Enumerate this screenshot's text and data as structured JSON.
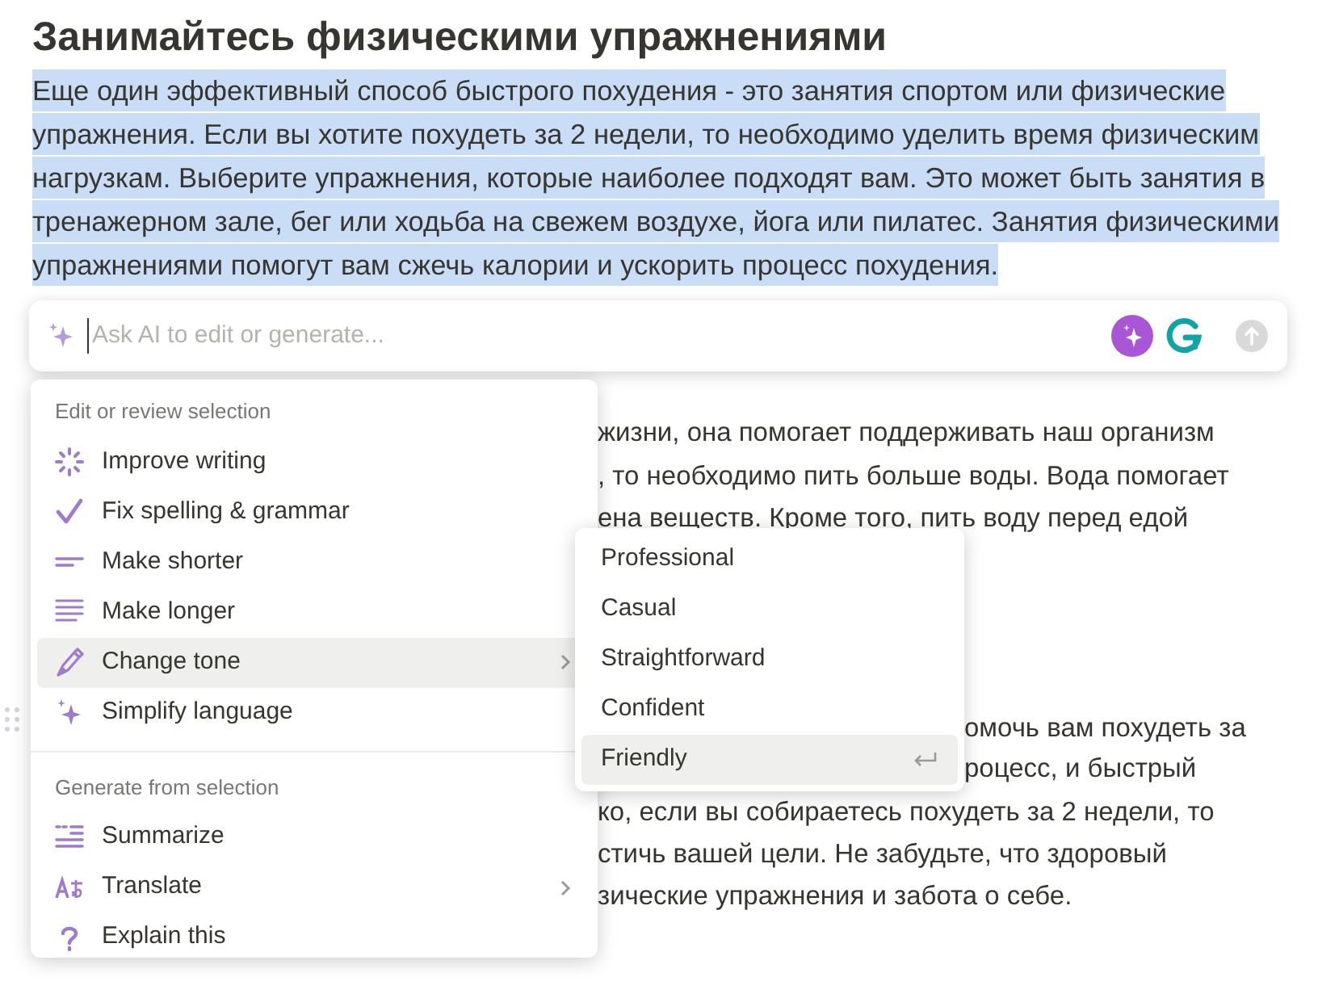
{
  "heading": "Занимайтесь физическими упражнениями",
  "selected_paragraph": {
    "selected": true,
    "lines": [
      "Еще один эффективный способ быстрого похудения - это занятия спортом или физические",
      "упражнения. Если вы хотите похудеть за 2 недели, то необходимо уделить время физическим",
      "нагрузкам. Выберите упражнения, которые наиболее подходят вам. Это может быть занятия в",
      "тренажерном зале, бег или ходьба на свежем воздухе, йога или пилатес. Занятия физическими",
      "упражнениями помогут вам сжечь калории и ускорить процесс похудения."
    ]
  },
  "background_text": [
    "жизни, она помогает поддерживать наш организм",
    ", то необходимо пить больше воды. Вода помогает",
    "ена веществ. Кроме того, пить воду перед едой",
    "омочь вам похудеть за",
    "роцесс, и быстрый",
    "ко, если вы собираетесь похудеть за 2 недели, то",
    "стичь вашей цели. Не забудьте, что здоровый",
    "зические упражнения и забота о себе."
  ],
  "ai_bar": {
    "placeholder": "Ask AI to edit or generate..."
  },
  "menu": {
    "sections": [
      {
        "title": "Edit or review selection",
        "items": [
          {
            "label": "Improve writing",
            "selected": false,
            "submenu": false
          },
          {
            "label": "Fix spelling & grammar",
            "selected": false,
            "submenu": false
          },
          {
            "label": "Make shorter",
            "selected": false,
            "submenu": false
          },
          {
            "label": "Make longer",
            "selected": false,
            "submenu": false
          },
          {
            "label": "Change tone",
            "selected": true,
            "submenu": true
          },
          {
            "label": "Simplify language",
            "selected": false,
            "submenu": false
          }
        ]
      },
      {
        "title": "Generate from selection",
        "items": [
          {
            "label": "Summarize",
            "selected": false,
            "submenu": false
          },
          {
            "label": "Translate",
            "selected": false,
            "submenu": true
          },
          {
            "label": "Explain this",
            "selected": false,
            "submenu": false
          }
        ]
      }
    ]
  },
  "tone_submenu": [
    {
      "label": "Professional",
      "selected": false
    },
    {
      "label": "Casual",
      "selected": false
    },
    {
      "label": "Straightforward",
      "selected": false
    },
    {
      "label": "Confident",
      "selected": false
    },
    {
      "label": "Friendly",
      "selected": true
    }
  ]
}
